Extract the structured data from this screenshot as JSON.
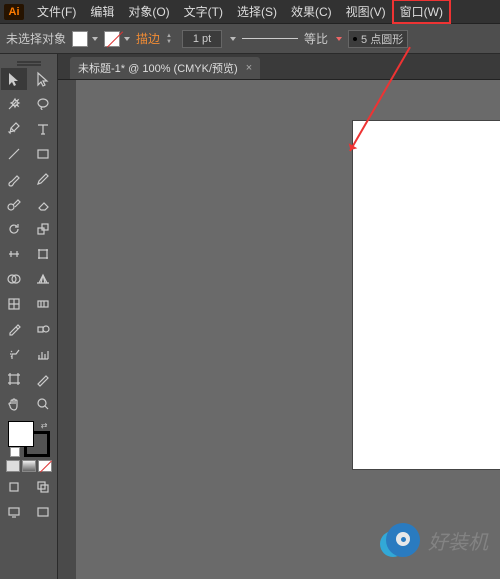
{
  "app": {
    "logo_text": "Ai"
  },
  "menu": {
    "file": "文件(F)",
    "edit": "编辑",
    "object": "对象(O)",
    "text": "文字(T)",
    "select": "选择(S)",
    "effect": "效果(C)",
    "view": "视图(V)",
    "window": "窗口(W)"
  },
  "options": {
    "selection_status": "未选择对象",
    "stroke_label": "描边",
    "stroke_weight": "1 pt",
    "profile_label": "等比",
    "brush_label": "5 点圆形",
    "bullet": "•"
  },
  "document": {
    "tab_title": "未标题-1* @ 100% (CMYK/预览)",
    "close_glyph": "×"
  },
  "tools": {
    "selection": "selection",
    "direct_selection": "direct-selection",
    "magic_wand": "magic-wand",
    "lasso": "lasso",
    "pen": "pen",
    "type": "type",
    "line": "line",
    "rectangle": "rectangle",
    "paintbrush": "paintbrush",
    "pencil": "pencil",
    "blob": "blob-brush",
    "eraser": "eraser",
    "rotate": "rotate",
    "scale": "scale",
    "width": "width",
    "free_transform": "free-transform",
    "shape_builder": "shape-builder",
    "perspective": "perspective-grid",
    "mesh": "mesh",
    "gradient": "gradient",
    "eyedropper": "eyedropper",
    "blend": "blend",
    "symbol_spray": "symbol-sprayer",
    "graph": "column-graph",
    "artboard": "artboard",
    "slice": "slice",
    "hand": "hand",
    "zoom": "zoom"
  },
  "watermark": {
    "text": "好装机"
  }
}
